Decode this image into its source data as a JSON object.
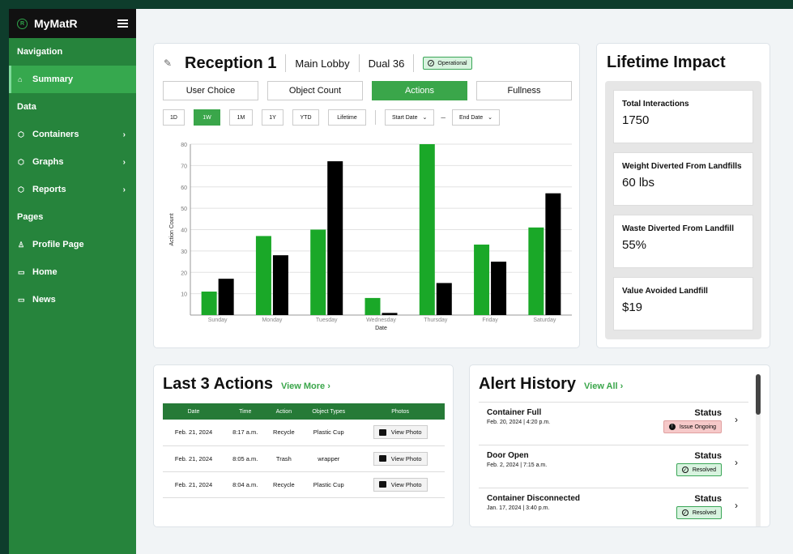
{
  "app": {
    "name": "MyMatR",
    "logo_letter": "R"
  },
  "sidebar": {
    "sections": [
      {
        "label": "Navigation",
        "items": [
          {
            "label": "Summary",
            "icon": "home-icon",
            "glyph": "⌂",
            "active": true,
            "chevron": false
          }
        ]
      },
      {
        "label": "Data",
        "items": [
          {
            "label": "Containers",
            "icon": "box-icon",
            "glyph": "⬡",
            "chevron": true
          },
          {
            "label": "Graphs",
            "icon": "box-icon",
            "glyph": "⬡",
            "chevron": true
          },
          {
            "label": "Reports",
            "icon": "box-icon",
            "glyph": "⬡",
            "chevron": true
          }
        ]
      },
      {
        "label": "Pages",
        "items": [
          {
            "label": "Profile Page",
            "icon": "user-icon",
            "glyph": "♙",
            "chevron": false
          },
          {
            "label": "Home",
            "icon": "square-icon",
            "glyph": "▭",
            "chevron": false
          },
          {
            "label": "News",
            "icon": "square-icon",
            "glyph": "▭",
            "chevron": false
          }
        ]
      }
    ]
  },
  "header": {
    "title": "Reception 1",
    "location": "Main Lobby",
    "model": "Dual 36",
    "status": "Operational"
  },
  "tabs": [
    {
      "label": "User Choice",
      "active": false
    },
    {
      "label": "Object Count",
      "active": false
    },
    {
      "label": "Actions",
      "active": true
    },
    {
      "label": "Fullness",
      "active": false
    }
  ],
  "ranges": [
    "1D",
    "1W",
    "1M",
    "1Y",
    "YTD",
    "Lifetime"
  ],
  "active_range": "1W",
  "date_filters": {
    "start": "Start Date",
    "end": "End Date",
    "separator": "–"
  },
  "chart_data": {
    "type": "bar",
    "categories": [
      "Sunday",
      "Monday",
      "Tuesday",
      "Wednesday",
      "Thursday",
      "Friday",
      "Saturday"
    ],
    "series": [
      {
        "values": [
          11,
          37,
          40,
          8,
          80,
          33,
          41
        ],
        "color": "#1aa828"
      },
      {
        "values": [
          17,
          28,
          72,
          1,
          15,
          25,
          57
        ],
        "color": "#000000"
      }
    ],
    "xlabel": "Date",
    "ylabel": "Action Count",
    "ylim": [
      0,
      80
    ],
    "yticks": [
      10,
      20,
      30,
      40,
      50,
      60,
      70,
      80
    ],
    "grid": true
  },
  "impact": {
    "title": "Lifetime Impact",
    "stats": [
      {
        "label": "Total Interactions",
        "value": "1750"
      },
      {
        "label": "Weight Diverted From Landfills",
        "value": "60 lbs"
      },
      {
        "label": "Waste Diverted From Landfill",
        "value": "55%"
      },
      {
        "label": "Value Avoided Landfill",
        "value": "$19"
      }
    ]
  },
  "last_actions": {
    "title": "Last 3 Actions",
    "link": "View More ›",
    "columns": [
      "Date",
      "Time",
      "Action",
      "Object Types",
      "Photos"
    ],
    "rows": [
      {
        "date": "Feb. 21, 2024",
        "time": "8:17 a.m.",
        "action": "Recycle",
        "object": "Plastic Cup",
        "photo": "View Photo"
      },
      {
        "date": "Feb. 21, 2024",
        "time": "8:05 a.m.",
        "action": "Trash",
        "object": "wrapper",
        "photo": "View Photo"
      },
      {
        "date": "Feb. 21, 2024",
        "time": "8:04 a.m.",
        "action": "Recycle",
        "object": "Plastic Cup",
        "photo": "View Photo"
      }
    ]
  },
  "alerts": {
    "title": "Alert History",
    "link": "View All ›",
    "items": [
      {
        "name": "Container Full",
        "date": "Feb. 20, 2024 | 4:20 p.m.",
        "status_label": "Status",
        "status": "Issue Ongoing",
        "kind": "red"
      },
      {
        "name": "Door Open",
        "date": "Feb. 2, 2024 | 7:15 a.m.",
        "status_label": "Status",
        "status": "Resolved",
        "kind": "green"
      },
      {
        "name": "Container Disconnected",
        "date": "Jan. 17, 2024 | 3:40 p.m.",
        "status_label": "Status",
        "status": "Resolved",
        "kind": "green"
      }
    ]
  }
}
